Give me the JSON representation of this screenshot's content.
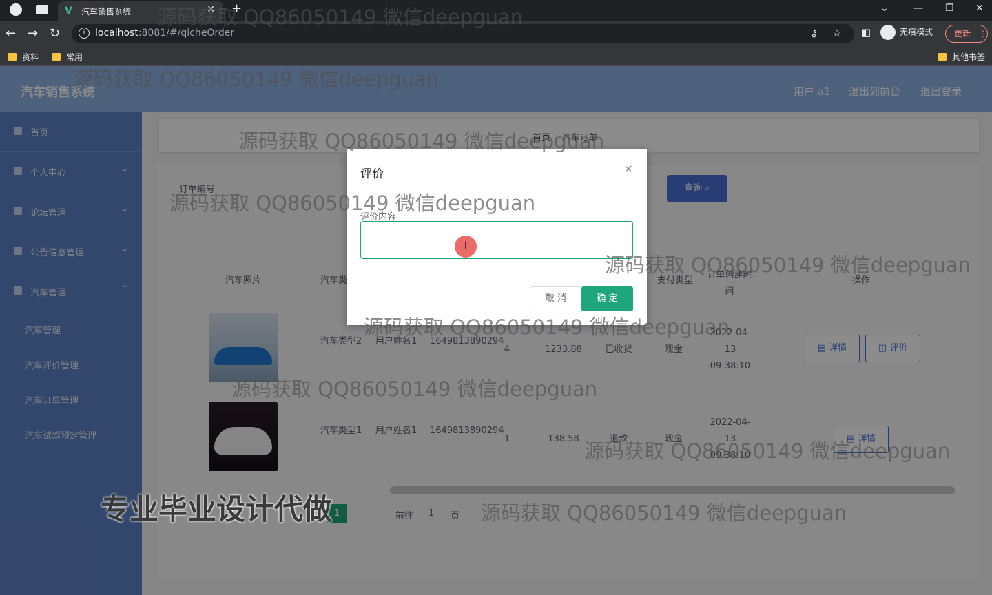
{
  "browser": {
    "tab_title": "汽车销售系统",
    "url_host": "localhost",
    "url_rest": ":8081/#/qicheOrder",
    "incognito_label": "无痕模式",
    "update_label": "更新",
    "bookmarks": [
      "资料",
      "常用"
    ],
    "other_bookmarks": "其他书签"
  },
  "header": {
    "logo": "汽车销售系统",
    "links": [
      "用户 a1",
      "退出到前台",
      "退出登录"
    ]
  },
  "sidebar": {
    "items": [
      {
        "label": "首页"
      },
      {
        "label": "个人中心"
      },
      {
        "label": "论坛管理"
      },
      {
        "label": "公告信息管理"
      },
      {
        "label": "汽车管理"
      }
    ],
    "subitems": [
      "汽车管理",
      "汽车评价管理",
      "汽车订单管理",
      "汽车试驾预定管理"
    ]
  },
  "breadcrumb": {
    "home": "首页",
    "current": "汽车订单"
  },
  "search": {
    "label": "订单编号",
    "button": "查询"
  },
  "table": {
    "headers": [
      "汽车照片",
      "汽车类型",
      "支付类型",
      "订单创建时间",
      "操作"
    ],
    "rows": [
      {
        "type": "汽车类型2",
        "user": "用户姓名1",
        "order_no": "1649813890294",
        "qty": "4",
        "price": "1233.88",
        "status": "已收货",
        "pay": "现金",
        "created": "2022-04-13 09:38:10",
        "actions": [
          "详情",
          "评价"
        ]
      },
      {
        "type": "汽车类型1",
        "user": "用户姓名1",
        "order_no": "1649813890294",
        "qty": "1",
        "price": "138.58",
        "status": "退款",
        "pay": "现金",
        "created": "2022-04-13 09:38:10",
        "actions": [
          "详情"
        ]
      }
    ]
  },
  "pager": {
    "goto": "前往",
    "page": "1",
    "unit": "页",
    "current": "1"
  },
  "dialog": {
    "title": "评价",
    "field_label": "评价内容",
    "field_value": "",
    "cancel": "取 消",
    "ok": "确 定"
  },
  "watermarks": {
    "text": "源码获取 QQ86050149 微信deepguan",
    "promo": "专业毕业设计代做"
  },
  "colors": {
    "accent_green": "#1fa67a",
    "primary_blue": "#4b6fd6",
    "header_blue": "#8fb3e6",
    "sidebar_blue": "#5e80c4"
  }
}
